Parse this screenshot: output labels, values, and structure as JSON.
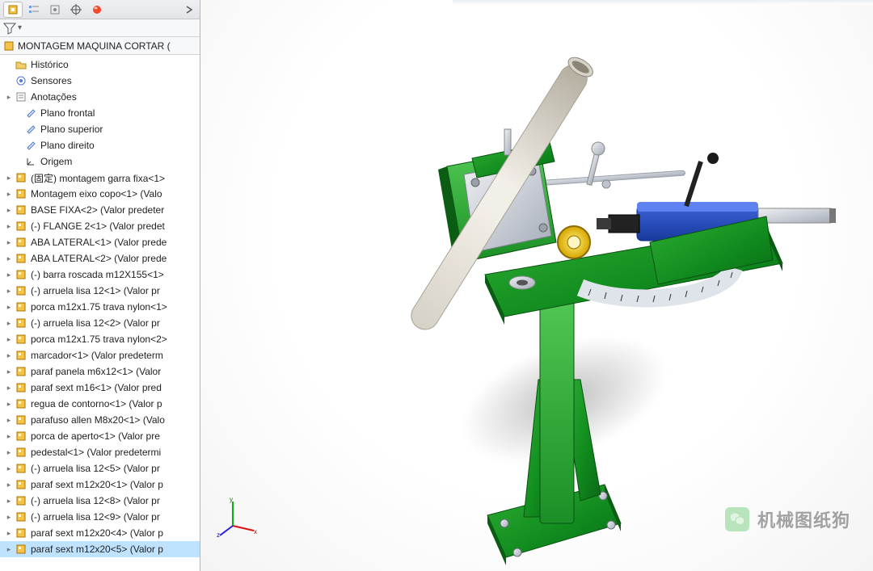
{
  "panel_tabs": [
    "assembly",
    "feature-tree",
    "config",
    "display",
    "appearance"
  ],
  "assembly_root": "MONTAGEM MAQUINA CORTAR  (",
  "filter_label": "",
  "top_nodes": [
    {
      "icon": "folder",
      "label": "Histórico",
      "exp": false
    },
    {
      "icon": "sensor",
      "label": "Sensores",
      "exp": false
    },
    {
      "icon": "annot",
      "label": "Anotações",
      "exp": true
    },
    {
      "icon": "plane",
      "label": "Plano frontal",
      "exp": false,
      "indent": 1
    },
    {
      "icon": "plane",
      "label": "Plano superior",
      "exp": false,
      "indent": 1
    },
    {
      "icon": "plane",
      "label": "Plano direito",
      "exp": false,
      "indent": 1
    },
    {
      "icon": "origin",
      "label": "Origem",
      "exp": false,
      "indent": 1
    }
  ],
  "parts": [
    "(固定) montagem garra fixa<1>",
    "Montagem eixo copo<1> (Valo",
    "BASE FIXA<2> (Valor predeter",
    "(-) FLANGE 2<1> (Valor predet",
    "ABA LATERAL<1> (Valor prede",
    "ABA LATERAL<2> (Valor prede",
    "(-) barra roscada m12X155<1>",
    "(-) arruela lisa 12<1> (Valor pr",
    "porca m12x1.75 trava nylon<1>",
    "(-) arruela lisa 12<2> (Valor pr",
    "porca m12x1.75 trava nylon<2>",
    "marcador<1> (Valor predeterm",
    "paraf panela m6x12<1> (Valor",
    "paraf sext m16<1> (Valor pred",
    "regua de contorno<1> (Valor p",
    "parafuso allen M8x20<1> (Valo",
    "porca de aperto<1> (Valor pre",
    "pedestal<1> (Valor predetermi",
    "(-) arruela lisa 12<5> (Valor pr",
    "paraf sext m12x20<1> (Valor p",
    "(-) arruela lisa 12<8> (Valor pr",
    "(-) arruela lisa 12<9> (Valor pr",
    "paraf sext m12x20<4> (Valor p",
    "paraf sext m12x20<5> (Valor p"
  ],
  "triad_labels": {
    "x": "x",
    "y": "y",
    "z": "z"
  },
  "watermark": {
    "text": "机械图纸狗",
    "icon": "wechat"
  }
}
